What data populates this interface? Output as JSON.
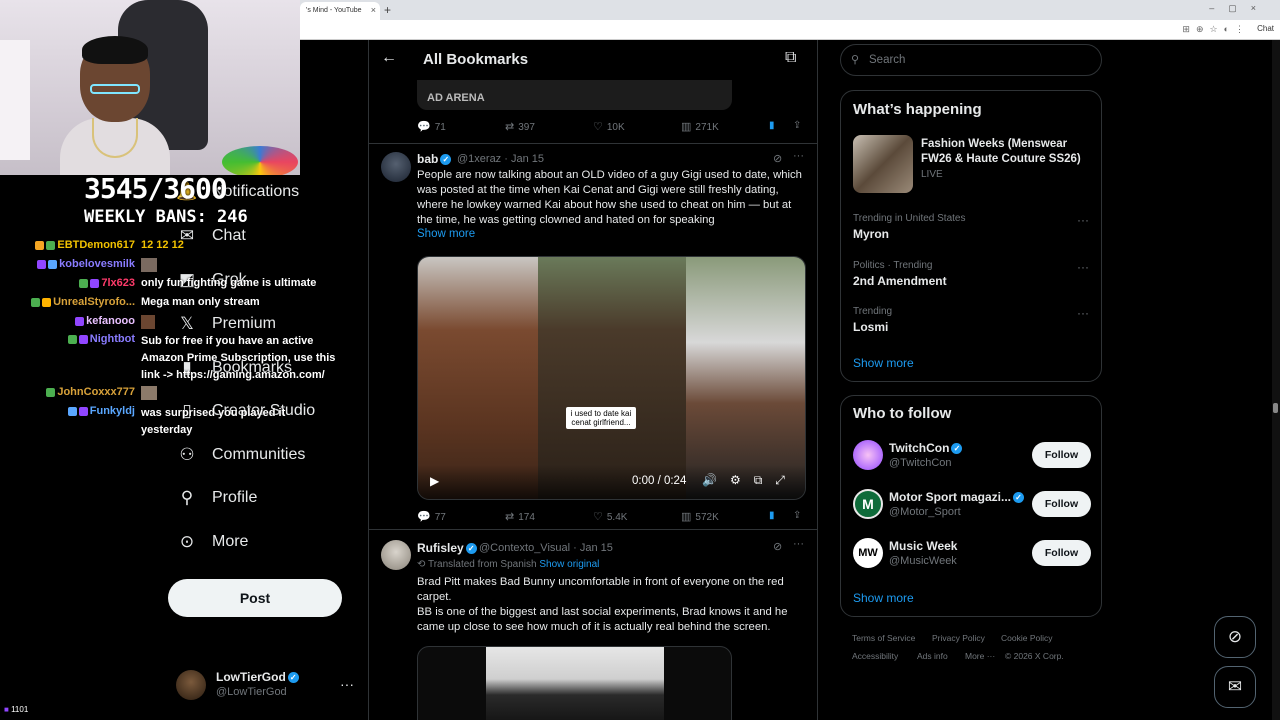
{
  "browser": {
    "tab_title": "'s Mind - YouTube",
    "tab_close": "×",
    "new_tab": "+",
    "window_controls": "–▢×",
    "chat_chip": "Chat"
  },
  "stream_overlay": {
    "counter": "3545/3600",
    "weekly_bans": "WEEKLY BANS: 246",
    "viewer_count": "1101",
    "chat": [
      {
        "user": "EBTDemon617",
        "user_color": "#f2c200",
        "message": "12 12 12"
      },
      {
        "user": "kobelovesmilk",
        "user_color": "#8a7cff",
        "message": ""
      },
      {
        "user": "7lx623",
        "user_color": "#ff3b6b",
        "message": "only fun fighting game is ultimate"
      },
      {
        "user": "UnrealStyrofo...",
        "user_color": "#d8a23a",
        "message": "Mega man only stream"
      },
      {
        "user": "kefanooo",
        "user_color": "#e8c0ff",
        "message": ""
      },
      {
        "user": "Nightbot",
        "user_color": "#8a7cff",
        "message": "Sub for free if you have an active Amazon Prime Subscription, use this link -> https://gaming.amazon.com/"
      },
      {
        "user": "JohnCoxxx777",
        "user_color": "#d8a23a",
        "message": ""
      },
      {
        "user": "Funkyldj",
        "user_color": "#5aa7ff",
        "message": "was surprised you played it yesterday"
      }
    ]
  },
  "nav": {
    "items": [
      {
        "label": "Notifications",
        "icon": "bell-icon",
        "glyph": "🔔"
      },
      {
        "label": "Chat",
        "icon": "mail-icon",
        "glyph": "✉"
      },
      {
        "label": "Grok",
        "icon": "grok-icon",
        "glyph": "◩"
      },
      {
        "label": "Premium",
        "icon": "x-logo-icon",
        "glyph": "𝕏"
      },
      {
        "label": "Bookmarks",
        "icon": "bookmark-icon",
        "glyph": "▮"
      },
      {
        "label": "Creator Studio",
        "icon": "studio-icon",
        "glyph": "▯"
      },
      {
        "label": "Communities",
        "icon": "communities-icon",
        "glyph": "⚇"
      },
      {
        "label": "Profile",
        "icon": "person-icon",
        "glyph": "⚲"
      },
      {
        "label": "More",
        "icon": "more-circle-icon",
        "glyph": "⊙"
      }
    ],
    "post_label": "Post",
    "account": {
      "name": "LowTierGod",
      "handle": "@LowTierGod",
      "more": "···"
    }
  },
  "timeline": {
    "title": "All Bookmarks",
    "back": "←",
    "action": "⧉",
    "top_actions": {
      "replies": "71",
      "reposts": "397",
      "likes": "10K",
      "views": "271K"
    },
    "tweet1": {
      "name": "bab",
      "meta": "@1xeraz · Jan 15",
      "text": "People are now talking about an OLD video of a guy Gigi used to date, which was posted at the time when Kai Cenat and Gigi were still freshly dating, where he lowkey warned Kai about how she used to cheat on him — but at the time, he was getting clowned and hated on for speaking",
      "show_more": "Show more",
      "video": {
        "time": "0:00 / 0:24",
        "caption": "i used to date kai cenat girlfriend..."
      },
      "actions": {
        "replies": "77",
        "reposts": "174",
        "likes": "5.4K",
        "views": "572K"
      }
    },
    "tweet2": {
      "name": "Rufisley",
      "meta": "@Contexto_Visual · Jan 15",
      "translated": "Translated from Spanish",
      "show_original": "Show original",
      "text": "Brad Pitt makes Bad Bunny uncomfortable in front of everyone on the red carpet.\nBB is one of the biggest and last social experiments, Brad knows it and he came up close to see how much of it is actually real behind the screen."
    }
  },
  "sidebar": {
    "search_placeholder": "Search",
    "happening": {
      "title": "What’s happening",
      "event": {
        "title": "Fashion Weeks (Menswear FW26 & Haute Couture SS26)",
        "status": "LIVE"
      },
      "trends": [
        {
          "context": "Trending in United States",
          "name": "Myron"
        },
        {
          "context": "Politics · Trending",
          "name": "2nd Amendment"
        },
        {
          "context": "Trending",
          "name": "Losmi"
        }
      ],
      "show_more": "Show more"
    },
    "who_to_follow": {
      "title": "Who to follow",
      "accounts": [
        {
          "name": "TwitchCon",
          "handle": "@TwitchCon",
          "follow": "Follow"
        },
        {
          "name": "Motor Sport magazi...",
          "handle": "@Motor_Sport",
          "follow": "Follow"
        },
        {
          "name": "Music Week",
          "handle": "@MusicWeek",
          "follow": "Follow"
        }
      ],
      "show_more": "Show more"
    },
    "footer": [
      "Terms of Service",
      "Privacy Policy",
      "Cookie Policy",
      "Accessibility",
      "Ads info",
      "More ···",
      "© 2026 X Corp."
    ]
  },
  "colors": {
    "accent": "#1d9bf0",
    "background": "#000000",
    "border": "#2f3336"
  }
}
